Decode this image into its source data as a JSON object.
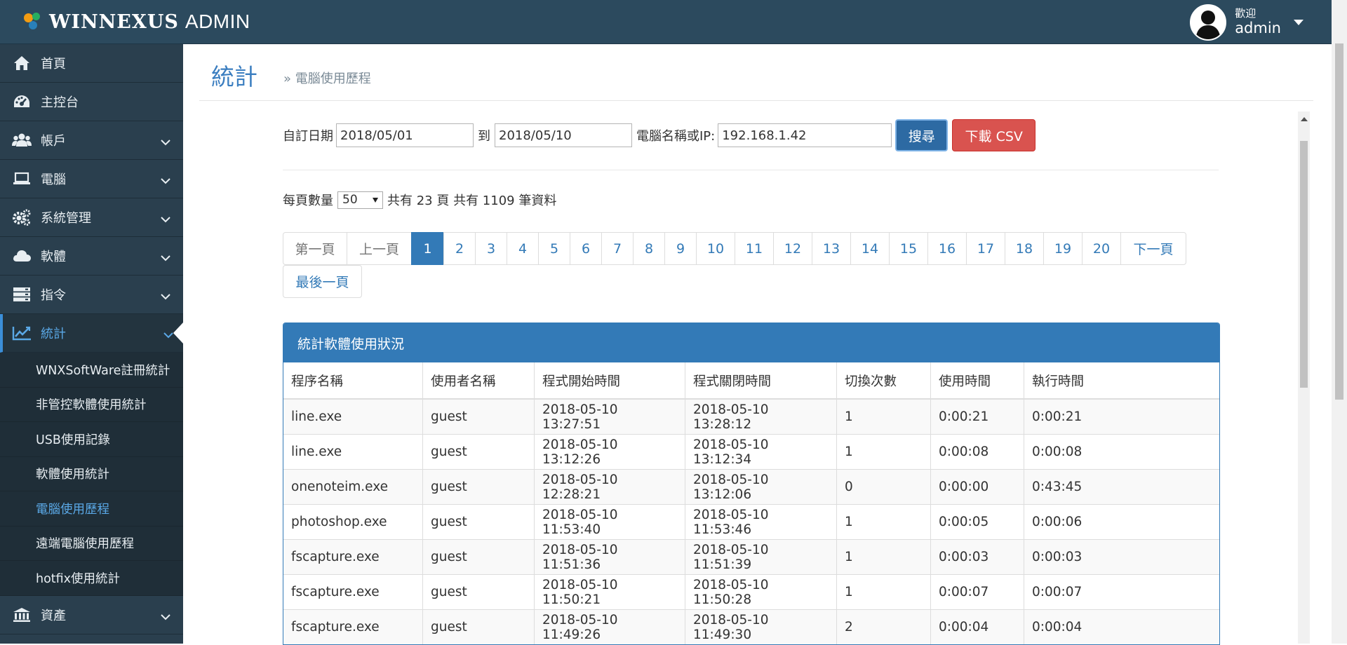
{
  "app": {
    "brand": "WINNEXUS",
    "brand_suffix": "ADMIN",
    "welcome": "歡迎",
    "username": "admin"
  },
  "sidebar": {
    "items": [
      {
        "label": "首頁",
        "icon": "home-icon"
      },
      {
        "label": "主控台",
        "icon": "dashboard-icon"
      },
      {
        "label": "帳戶",
        "icon": "users-icon"
      },
      {
        "label": "電腦",
        "icon": "laptop-icon"
      },
      {
        "label": "系統管理",
        "icon": "cogs-icon"
      },
      {
        "label": "軟體",
        "icon": "cloud-icon"
      },
      {
        "label": "指令",
        "icon": "server-icon"
      },
      {
        "label": "統計",
        "icon": "line-chart-icon"
      }
    ],
    "submenu": [
      "WNXSoftWare註冊統計",
      "非管控軟體使用統計",
      "USB使用記錄",
      "軟體使用統計",
      "電腦使用歷程",
      "遠端電腦使用歷程",
      "hotfix使用統計"
    ],
    "bottom_item": {
      "label": "資產",
      "icon": "bank-icon"
    }
  },
  "page": {
    "title": "統計",
    "breadcrumb": "» 電腦使用歷程"
  },
  "filter": {
    "date_label": "自訂日期",
    "date_from": "2018/05/01",
    "to_label": "到",
    "date_to": "2018/05/10",
    "pc_label": "電腦名稱或IP:",
    "pc_value": "192.168.1.42",
    "search_button": "搜尋",
    "csv_button": "下載 CSV"
  },
  "paging": {
    "per_page_label": "每頁數量",
    "per_page_value": "50",
    "summary": "共有 23 頁 共有 1109 筆資料",
    "first": "第一頁",
    "prev": "上一頁",
    "pages": [
      "1",
      "2",
      "3",
      "4",
      "5",
      "6",
      "7",
      "8",
      "9",
      "10",
      "11",
      "12",
      "13",
      "14",
      "15",
      "16",
      "17",
      "18",
      "19",
      "20"
    ],
    "current_page": "1",
    "next": "下一頁",
    "last": "最後一頁"
  },
  "table": {
    "title": "統計軟體使用狀況",
    "columns": [
      "程序名稱",
      "使用者名稱",
      "程式開始時間",
      "程式關閉時間",
      "切換次數",
      "使用時間",
      "執行時間"
    ],
    "rows": [
      [
        "line.exe",
        "guest",
        "2018-05-10 13:27:51",
        "2018-05-10 13:28:12",
        "1",
        "0:00:21",
        "0:00:21"
      ],
      [
        "line.exe",
        "guest",
        "2018-05-10 13:12:26",
        "2018-05-10 13:12:34",
        "1",
        "0:00:08",
        "0:00:08"
      ],
      [
        "onenoteim.exe",
        "guest",
        "2018-05-10 12:28:21",
        "2018-05-10 13:12:06",
        "0",
        "0:00:00",
        "0:43:45"
      ],
      [
        "photoshop.exe",
        "guest",
        "2018-05-10 11:53:40",
        "2018-05-10 11:53:46",
        "1",
        "0:00:05",
        "0:00:06"
      ],
      [
        "fscapture.exe",
        "guest",
        "2018-05-10 11:51:36",
        "2018-05-10 11:51:39",
        "1",
        "0:00:03",
        "0:00:03"
      ],
      [
        "fscapture.exe",
        "guest",
        "2018-05-10 11:50:21",
        "2018-05-10 11:50:28",
        "1",
        "0:00:07",
        "0:00:07"
      ],
      [
        "fscapture.exe",
        "guest",
        "2018-05-10 11:49:26",
        "2018-05-10 11:49:30",
        "2",
        "0:00:04",
        "0:00:04"
      ]
    ]
  },
  "colors": {
    "topbar": "#2c4a5e",
    "sidebar": "#2a3f4e",
    "accent": "#337ab7",
    "danger": "#d9534f",
    "title": "#3b7ec0"
  }
}
